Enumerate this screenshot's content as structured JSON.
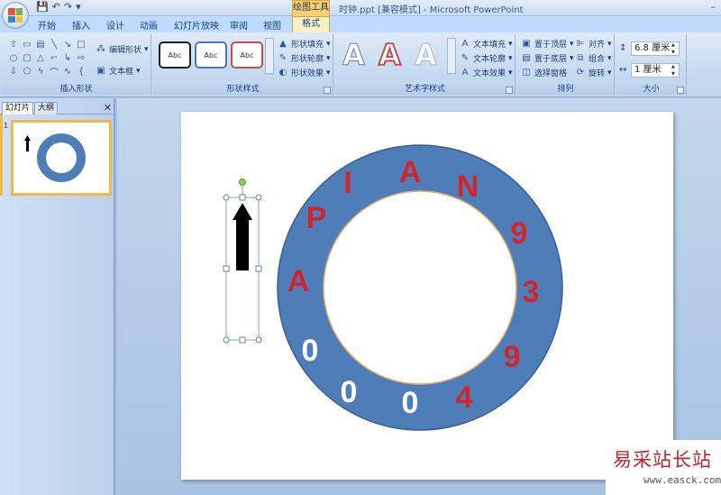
{
  "titlebar": {
    "tool_context": "绘图工具",
    "window_title": "时钟.ppt [兼容模式] - Microsoft PowerPoint",
    "minimize": "–"
  },
  "tabs": [
    {
      "label": "开始"
    },
    {
      "label": "插入"
    },
    {
      "label": "设计"
    },
    {
      "label": "动画"
    },
    {
      "label": "幻灯片放映"
    },
    {
      "label": "审阅"
    },
    {
      "label": "视图"
    },
    {
      "label": "格式"
    }
  ],
  "ribbon": {
    "insert_shapes": {
      "label": "插入形状",
      "edit_shape": "编辑形状",
      "text_box": "文本框"
    },
    "shape_styles": {
      "label": "形状样式",
      "sample": "Abc",
      "fill": "形状填充",
      "outline": "形状轮廓",
      "effects": "形状效果"
    },
    "wordart_styles": {
      "label": "艺术字样式",
      "sample": "A",
      "text_fill": "文本填充",
      "text_outline": "文本轮廓",
      "text_effects": "文本效果"
    },
    "arrange": {
      "label": "排列",
      "bring_front": "置于顶层",
      "send_back": "置于底层",
      "selection_pane": "选择窗格",
      "align": "对齐",
      "group": "组合",
      "rotate": "旋转"
    },
    "size": {
      "label": "大小",
      "height": "6.8 厘米",
      "width": "1 厘米"
    }
  },
  "left_panel": {
    "tab_slides": "幻灯片",
    "tab_outline": "大纲",
    "close": "✕",
    "slide_number": "1"
  },
  "slide": {
    "ring_letters": [
      "P",
      "I",
      "A",
      "N",
      "A",
      "9",
      "3",
      "9",
      "4",
      "0",
      "0",
      "0"
    ]
  },
  "watermark": {
    "site": "易采站长站",
    "url": "www.easck.com"
  },
  "colors": {
    "ring": "#4f7db8",
    "letters_red": "#d0242e",
    "numbers_white": "#ffffff",
    "accent": "#f2b84b"
  }
}
